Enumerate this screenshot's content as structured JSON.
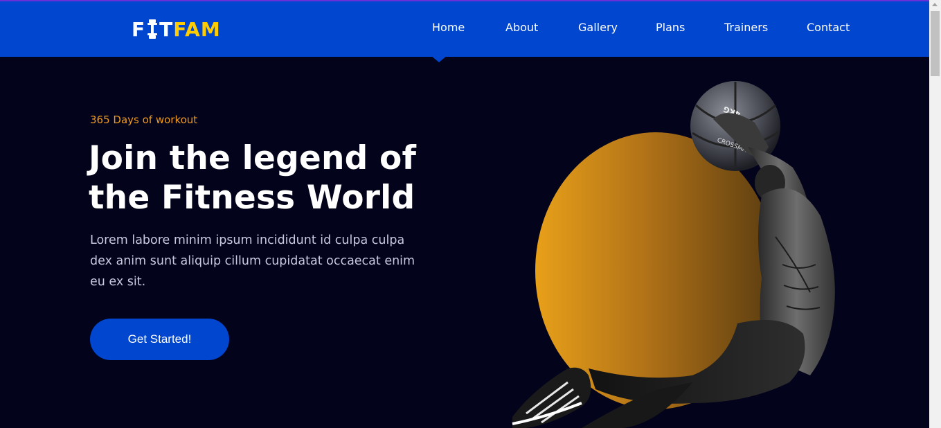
{
  "brand": {
    "logo_part1": "F",
    "logo_part2": "T",
    "logo_part3": "FAM",
    "colors": {
      "primary": "#0146cf",
      "accent": "#f09a1e",
      "logo_accent": "#ffcc00",
      "background": "#03031c"
    }
  },
  "nav": {
    "items": [
      {
        "label": "Home",
        "active": true
      },
      {
        "label": "About"
      },
      {
        "label": "Gallery"
      },
      {
        "label": "Plans"
      },
      {
        "label": "Trainers"
      },
      {
        "label": "Contact"
      }
    ]
  },
  "hero": {
    "subtitle": "365 Days of workout",
    "title": "Join the legend of the Fitness World",
    "description": "Lorem labore minim ipsum incididunt id culpa culpa dex anim sunt aliquip cillum cupidatat occaecat enim eu ex sit.",
    "cta_label": "Get Started!",
    "ball_text": "CROSSMAXX",
    "ball_weight": "4KG"
  },
  "icons": {
    "logo_letter": "dumbbell-icon"
  }
}
